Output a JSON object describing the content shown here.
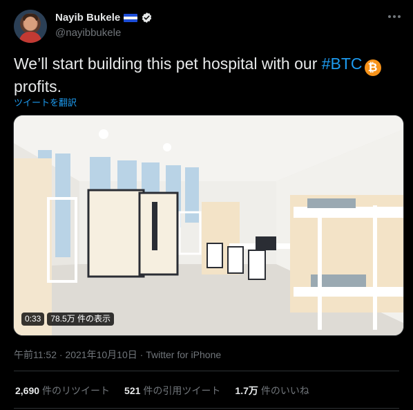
{
  "author": {
    "name": "Nayib Bukele",
    "handle": "@nayibbukele",
    "flag_colors": [
      "#1d4ed8",
      "#f4f4f4",
      "#1d4ed8"
    ]
  },
  "tweet": {
    "text_before": "We’ll start building this pet hospital with our ",
    "hashtag": "#BTC",
    "btc_glyph": "₿",
    "text_after": "profits.",
    "translate_label": "ツイートを翻訳"
  },
  "media": {
    "duration": "0:33",
    "views": "78.5万 件の表示"
  },
  "meta": {
    "time": "午前11:52",
    "separator": " · ",
    "date": "2021年10月10日",
    "source": "Twitter for iPhone"
  },
  "stats": {
    "retweets_count": "2,690",
    "retweets_label": "件のリツイート",
    "quotes_count": "521",
    "quotes_label": "件の引用ツイート",
    "likes_count": "1.7万",
    "likes_label": "件のいいね"
  },
  "colors": {
    "background": "#000000",
    "link": "#1d9bf0",
    "muted": "#71767b",
    "btc": "#f7931a"
  }
}
